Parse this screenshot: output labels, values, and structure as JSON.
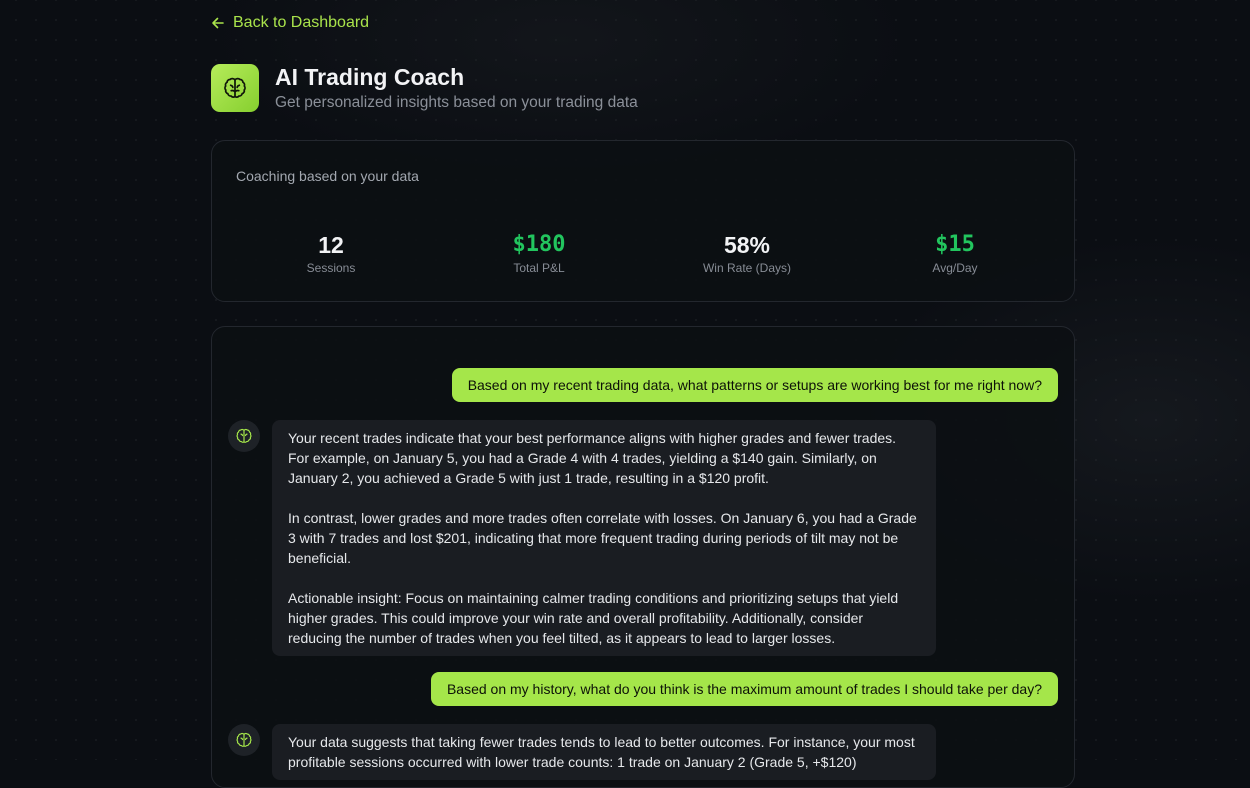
{
  "nav": {
    "back_label": "Back to Dashboard"
  },
  "header": {
    "title": "AI Trading Coach",
    "subtitle": "Get personalized insights based on your trading data"
  },
  "stats": {
    "label": "Coaching based on your data",
    "items": [
      {
        "value": "12",
        "label": "Sessions"
      },
      {
        "value": "$180",
        "label": "Total P&L"
      },
      {
        "value": "58%",
        "label": "Win Rate (Days)"
      },
      {
        "value": "$15",
        "label": "Avg/Day"
      }
    ]
  },
  "chat": {
    "messages": [
      {
        "role": "user",
        "text": "Based on my recent trading data, what patterns or setups are working best for me right now?"
      },
      {
        "role": "assistant",
        "paragraphs": [
          "Your recent trades indicate that your best performance aligns with higher grades and fewer trades. For example, on January 5, you had a Grade 4 with 4 trades, yielding a $140 gain. Similarly, on January 2, you achieved a Grade 5 with just 1 trade, resulting in a $120 profit.",
          "In contrast, lower grades and more trades often correlate with losses. On January 6, you had a Grade 3 with 7 trades and lost $201, indicating that more frequent trading during periods of tilt may not be beneficial.",
          "Actionable insight: Focus on maintaining calmer trading conditions and prioritizing setups that yield higher grades. This could improve your win rate and overall profitability. Additionally, consider reducing the number of trades when you feel tilted, as it appears to lead to larger losses."
        ]
      },
      {
        "role": "user",
        "text": "Based on my history, what do you think is the maximum amount of trades I should take per day?"
      },
      {
        "role": "assistant",
        "paragraphs": [
          "Your data suggests that taking fewer trades tends to lead to better outcomes. For instance, your most profitable sessions occurred with lower trade counts: 1 trade on January 2 (Grade 5, +$120)"
        ]
      }
    ]
  },
  "colors": {
    "accent": "#a5e64a",
    "profit": "#22c55e",
    "background": "#0b0e13"
  }
}
